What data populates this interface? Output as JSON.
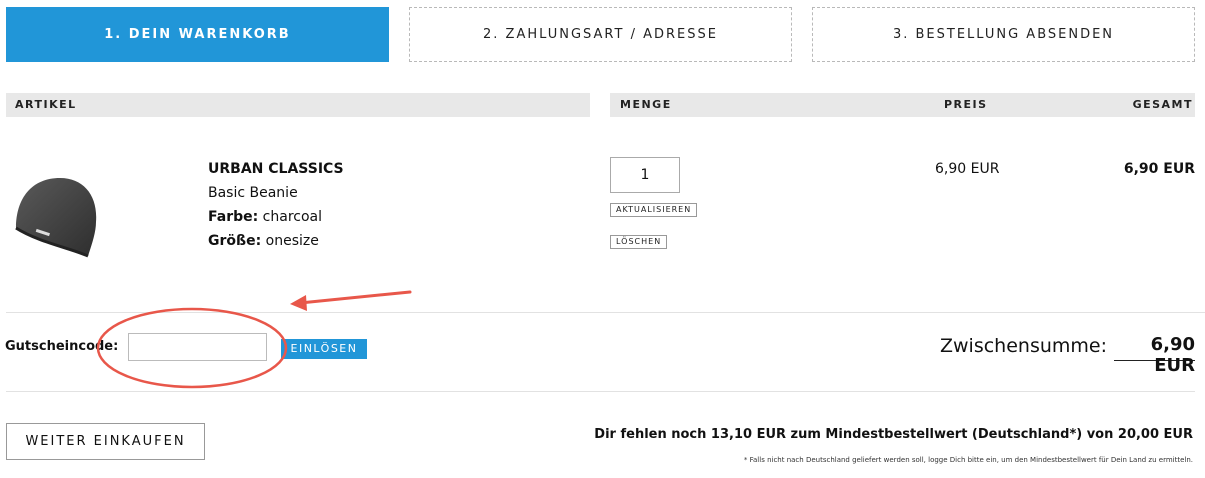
{
  "steps": [
    {
      "label": "1. DEIN WARENKORB"
    },
    {
      "label": "2. ZAHLUNGSART / ADRESSE"
    },
    {
      "label": "3. BESTELLUNG ABSENDEN"
    }
  ],
  "table_headers": {
    "artikel": "ARTIKEL",
    "menge": "MENGE",
    "preis": "PREIS",
    "gesamt": "GESAMT"
  },
  "item": {
    "brand": "URBAN CLASSICS",
    "name": "Basic Beanie",
    "color_label": "Farbe:",
    "color_value": " charcoal",
    "size_label": "Größe:",
    "size_value": " onesize",
    "quantity": "1",
    "update_label": "AKTUALISIEREN",
    "delete_label": "LÖSCHEN",
    "unit_price": "6,90 EUR",
    "total_price": "6,90 EUR",
    "image_icon": "beanie-image"
  },
  "coupon": {
    "label": "Gutscheincode:",
    "value": "",
    "button_label": "EINLÖSEN"
  },
  "summary": {
    "subtotal_label": "Zwischensumme:",
    "subtotal_value": "6,90 EUR"
  },
  "footer": {
    "continue_label": "WEITER EINKAUFEN",
    "min_order_text": "Dir fehlen noch 13,10 EUR zum Mindestbestellwert (Deutschland*) von 20,00 EUR",
    "footnote": "* Falls nicht nach Deutschland geliefert werden soll, logge Dich bitte ein, um den Mindestbestellwert für Dein Land zu ermitteln."
  },
  "colors": {
    "accent": "#2196d8",
    "annotation": "#e8574a",
    "header_bg": "#e8e8e8"
  }
}
